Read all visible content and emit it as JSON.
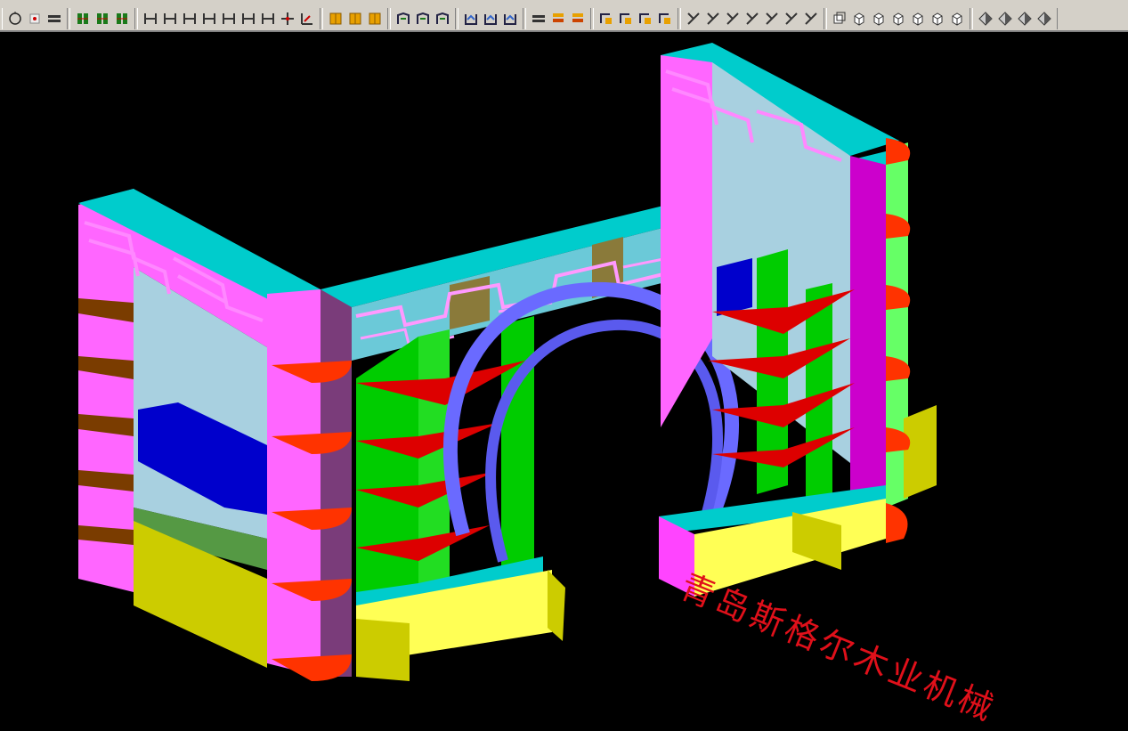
{
  "app": {
    "accent": "#d4d0c8",
    "viewport_background": "#000000"
  },
  "toolbar": {
    "groups": [
      {
        "name": "view",
        "icons": [
          "orbit-icon",
          "point-icon",
          "layer-icon"
        ]
      },
      {
        "name": "cabinet",
        "icons": [
          "cabinet-icon",
          "cabinet-icon",
          "cabinet-icon"
        ]
      },
      {
        "name": "panel",
        "icons": [
          "panel-icon",
          "panel-icon",
          "panel-icon",
          "panel-icon",
          "panel-icon",
          "panel-icon",
          "panel-icon",
          "move-icon",
          "measure-icon"
        ]
      },
      {
        "name": "door",
        "icons": [
          "door-icon",
          "door-icon",
          "door-icon"
        ]
      },
      {
        "name": "frame",
        "icons": [
          "frame-icon",
          "frame-icon",
          "frame-icon"
        ]
      },
      {
        "name": "base",
        "icons": [
          "base-icon",
          "base-icon",
          "base-icon"
        ]
      },
      {
        "name": "layer",
        "icons": [
          "layer-icon",
          "stack-icon",
          "stack-icon"
        ]
      },
      {
        "name": "edit",
        "icons": [
          "edit-icon",
          "edit-icon",
          "edit-icon",
          "edit-icon"
        ]
      },
      {
        "name": "draw",
        "icons": [
          "draw-icon",
          "draw-icon",
          "draw-icon",
          "draw-icon",
          "draw-icon",
          "draw-icon",
          "draw-icon"
        ]
      },
      {
        "name": "view3d",
        "icons": [
          "copy-icon",
          "cube-icon",
          "cube-icon",
          "cube-icon",
          "cube-icon",
          "cube-icon",
          "cube-icon"
        ]
      },
      {
        "name": "shade",
        "icons": [
          "shade-icon",
          "shade-icon",
          "shade-icon",
          "shade-icon"
        ]
      }
    ]
  },
  "viewport": {
    "watermark": "青岛斯格尔木业机械"
  }
}
